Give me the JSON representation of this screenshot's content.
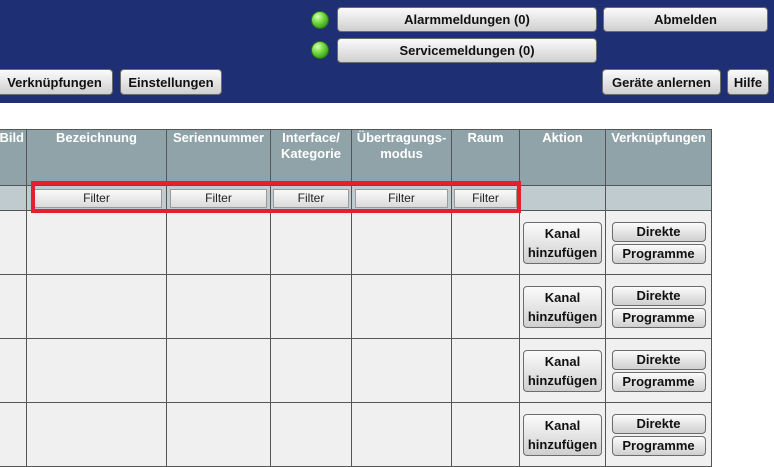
{
  "header": {
    "alarm_label": "Alarmmeldungen (0)",
    "service_label": "Servicemeldungen (0)",
    "logout_label": "Abmelden",
    "links_label": "Verknüpfungen",
    "settings_label": "Einstellungen",
    "teach_label": "Geräte anlernen",
    "help_label": "Hilfe",
    "alarm_status_color": "#3aa21c",
    "service_status_color": "#3aa21c"
  },
  "table": {
    "columns": {
      "bild": "Bild",
      "bezeichnung": "Bezeichnung",
      "seriennummer": "Seriennummer",
      "interface_line1": "Interface/",
      "interface_line2": "Kategorie",
      "uebertragung_line1": "Übertragungs-",
      "uebertragung_line2": "modus",
      "raum": "Raum",
      "aktion": "Aktion",
      "verknuepfungen": "Verknüpfungen"
    },
    "filters": [
      "Filter",
      "Filter",
      "Filter",
      "Filter",
      "Filter"
    ],
    "row_actions": {
      "add_channel_line1": "Kanal",
      "add_channel_line2": "hinzufügen",
      "direct": "Direkte",
      "programs": "Programme"
    }
  },
  "highlight_color": "#e4212b"
}
